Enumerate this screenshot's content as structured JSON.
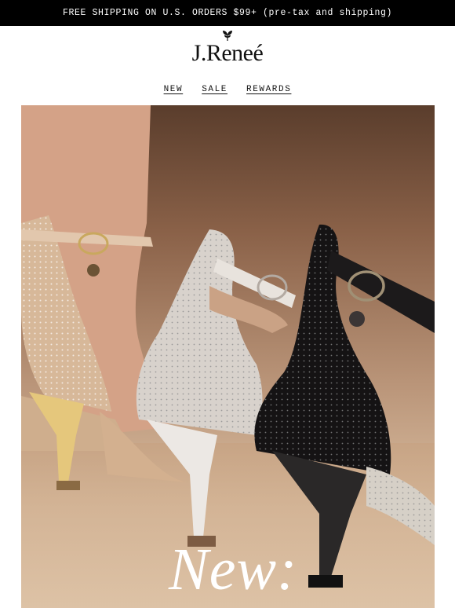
{
  "promo": {
    "text": "FREE SHIPPING ON U.S. ORDERS $99+ (pre-tax and shipping)"
  },
  "brand": {
    "logo_text": "J.Reneé",
    "logo_icon": "leaf-sprout-icon"
  },
  "nav": {
    "items": [
      "NEW",
      "SALE",
      "REWARDS"
    ]
  },
  "hero": {
    "headline": "New:",
    "image": "hero-shoes-image",
    "colors": {
      "nude": "#d7b899",
      "silver": "#d8d2cc",
      "black": "#151314"
    }
  }
}
